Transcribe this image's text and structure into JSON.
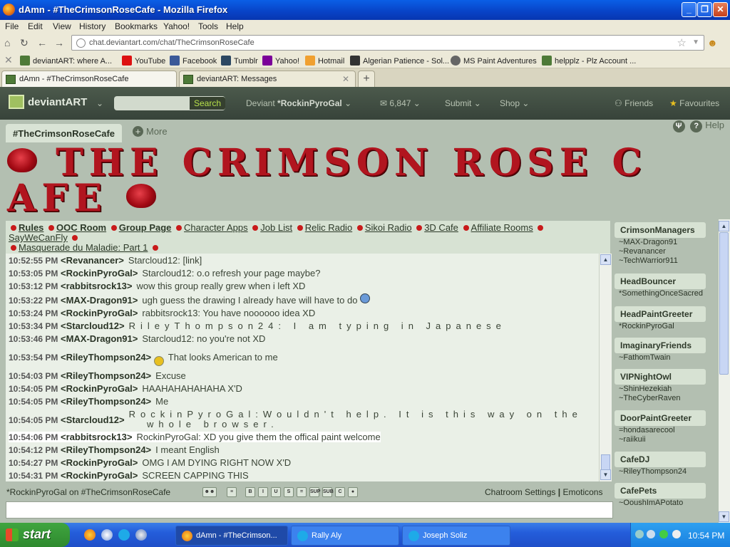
{
  "window": {
    "title": "dAmn - #TheCrimsonRoseCafe - Mozilla Firefox",
    "controls": [
      "_",
      "❐",
      "✕"
    ]
  },
  "menu": [
    "File",
    "Edit",
    "View",
    "History",
    "Bookmarks",
    "Yahoo!",
    "Tools",
    "Help"
  ],
  "address": {
    "url": "chat.deviantart.com/chat/TheCrimsonRoseCafe"
  },
  "bookmarks": [
    {
      "label": "deviantART: where A...",
      "color": "#4e7a38"
    },
    {
      "label": "YouTube",
      "color": "#d11"
    },
    {
      "label": "Facebook",
      "color": "#3b5998"
    },
    {
      "label": "Tumblr",
      "color": "#2c4762"
    },
    {
      "label": "Yahoo!",
      "color": "#7b0099"
    },
    {
      "label": "Hotmail",
      "color": "#f0a030"
    },
    {
      "label": "Algerian Patience - Sol...",
      "color": "#333"
    },
    {
      "label": "MS Paint Adventures",
      "color": "#666"
    },
    {
      "label": "helpplz - Plz Account ...",
      "color": "#4e7a38"
    }
  ],
  "tabs": [
    {
      "label": "dAmn - #TheCrimsonRoseCafe",
      "active": true
    },
    {
      "label": "deviantART: Messages",
      "active": false
    }
  ],
  "newtab": "+",
  "da": {
    "logo": "deviantART",
    "search_button": "Search",
    "user_prefix": "Deviant",
    "user": "*RockinPyroGal",
    "messages": "6,847",
    "submit": "Submit",
    "shop": "Shop",
    "friends": "Friends",
    "favourites": "Favourites"
  },
  "channel": {
    "tab": "#TheCrimsonRoseCafe",
    "more": "More",
    "help": "Help"
  },
  "banner": {
    "line1": "THE  CRIMSON  ROSE  C",
    "line2": "AFE"
  },
  "links": [
    "Rules",
    "OOC Room",
    "Group Page",
    "Character Apps",
    "Job List",
    "Relic Radio",
    "Sikoi Radio",
    "3D Cafe",
    "Affiliate Rooms",
    "SayWeCanFly",
    "Masquerade du Maladie: Part 1"
  ],
  "messages": [
    {
      "time": "10:52:55 PM",
      "nick": "<Revanancer>",
      "text": "Starcloud12: [link]"
    },
    {
      "time": "10:53:05 PM",
      "nick": "<RockinPyroGal>",
      "text": "Starcloud12: o.o refresh your page maybe?"
    },
    {
      "time": "10:53:12 PM",
      "nick": "<rabbitsrock13>",
      "text": "wow this group really grew when i left XD"
    },
    {
      "time": "10:53:22 PM",
      "nick": "<MAX-Dragon91>",
      "text": "ugh guess the drawing I already have will have to do"
    },
    {
      "time": "10:53:24 PM",
      "nick": "<RockinPyroGal>",
      "text": "rabbitsrock13: You have noooooo idea XD"
    },
    {
      "time": "10:53:34 PM",
      "nick": "<Starcloud12>",
      "text": "RileyThompson24: I am typing in Japanese"
    },
    {
      "time": "10:53:46 PM",
      "nick": "<MAX-Dragon91>",
      "text": "Starcloud12: no you're not XD"
    },
    {
      "time": "10:53:54 PM",
      "nick": "<RileyThompson24>",
      "text": "That looks American to me"
    },
    {
      "time": "10:54:03 PM",
      "nick": "<RileyThompson24>",
      "text": "Excuse"
    },
    {
      "time": "10:54:05 PM",
      "nick": "<RockinPyroGal>",
      "text": "HAAHAHAHAHAHA X'D"
    },
    {
      "time": "10:54:05 PM",
      "nick": "<RileyThompson24>",
      "text": "Me"
    },
    {
      "time": "10:54:05 PM",
      "nick": "<Starcloud12>",
      "text": "RockinPyroGal:Wouldn't help. It is this way on the"
    },
    {
      "time": "",
      "nick": "",
      "text": "whole browser."
    },
    {
      "time": "10:54:06 PM",
      "nick": "<rabbitsrock13>",
      "text": "RockinPyroGal: XD you give them the offical paint welcome"
    },
    {
      "time": "10:54:12 PM",
      "nick": "<RileyThompson24>",
      "text": "I meant English"
    },
    {
      "time": "10:54:27 PM",
      "nick": "<RockinPyroGal>",
      "text": "OMG I AM DYING RIGHT NOW X'D"
    },
    {
      "time": "10:54:31 PM",
      "nick": "<RockinPyroGal>",
      "text": "SCREEN CAPPING THIS"
    }
  ],
  "sidebar": [
    {
      "group": "CrimsonManagers",
      "members": [
        "~MAX-Dragon91",
        "~Revanancer",
        "~TechWarrior911"
      ]
    },
    {
      "group": "HeadBouncer",
      "members": [
        "*SomethingOnceSacred"
      ]
    },
    {
      "group": "HeadPaintGreeter",
      "members": [
        "*RockinPyroGal"
      ]
    },
    {
      "group": "ImaginaryFriends",
      "members": [
        "~FathomTwain"
      ]
    },
    {
      "group": "VIPNightOwl",
      "members": [
        "~ShinHezekiah",
        "~TheCyberRaven"
      ]
    },
    {
      "group": "DoorPaintGreeter",
      "members": [
        "=hondasarecool",
        "~raiikuii"
      ]
    },
    {
      "group": "CafeDJ",
      "members": [
        "~RileyThompson24"
      ]
    },
    {
      "group": "CafePets",
      "members": [
        "~OoushImAPotato"
      ]
    }
  ],
  "input": {
    "who": "*RockinPyroGal on #TheCrimsonRoseCafe",
    "settings": "Chatroom Settings",
    "separator": "|",
    "emoticons": "Emoticons",
    "format_buttons": [
      "B",
      "I",
      "U",
      "S",
      "=",
      "SUP",
      "SUB",
      "C",
      "●"
    ]
  },
  "taskbar": {
    "start": "start",
    "items": [
      "dAmn - #TheCrimson...",
      "Rally Aly",
      "Joseph Soliz"
    ],
    "clock": "10:54 PM"
  }
}
